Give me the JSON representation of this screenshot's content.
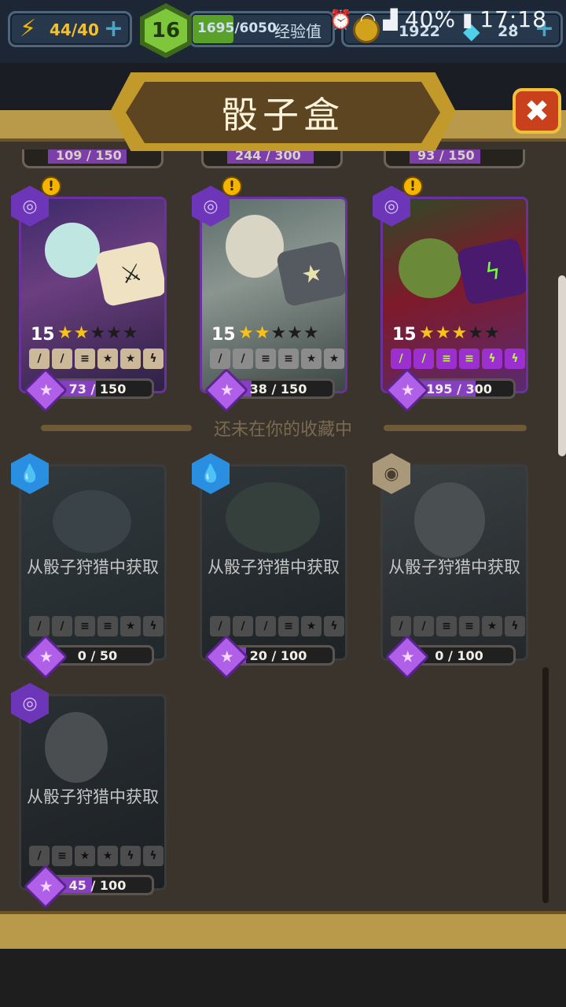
{
  "hud": {
    "energy": "44/40",
    "level": "16",
    "xp": "1695/6050",
    "xp_label": "经验值",
    "coins": "1922",
    "gems": "28"
  },
  "statusbar": {
    "battery": "40%",
    "time": "17:18"
  },
  "panel": {
    "title": "骰子盒",
    "section_not_collected": "还未在你的收藏中"
  },
  "peek_cards": [
    {
      "progress": "109 / 150"
    },
    {
      "progress": "244 / 300"
    },
    {
      "progress": "93 / 150"
    }
  ],
  "collected": [
    {
      "level": "15",
      "stars": 2,
      "progress": "73 / 150",
      "progress_value": 73,
      "progress_max": 150
    },
    {
      "level": "15",
      "stars": 2,
      "progress": "38 / 150",
      "progress_value": 38,
      "progress_max": 150
    },
    {
      "level": "15",
      "stars": 3,
      "progress": "195 / 300",
      "progress_value": 195,
      "progress_max": 300
    }
  ],
  "uncollected": [
    {
      "obtain_text": "从骰子狩猎中获取",
      "progress": "0 / 50",
      "progress_value": 0,
      "progress_max": 50
    },
    {
      "obtain_text": "从骰子狩猎中获取",
      "progress": "20 / 100",
      "progress_value": 20,
      "progress_max": 100
    },
    {
      "obtain_text": "从骰子狩猎中获取",
      "progress": "0 / 100",
      "progress_value": 0,
      "progress_max": 100
    },
    {
      "obtain_text": "从骰子狩猎中获取",
      "progress": "45 / 100",
      "progress_value": 45,
      "progress_max": 100
    }
  ],
  "colors": {
    "accent_purple": "#8440c0",
    "frame_gold": "#c29a2c",
    "close_red": "#c8401c"
  }
}
